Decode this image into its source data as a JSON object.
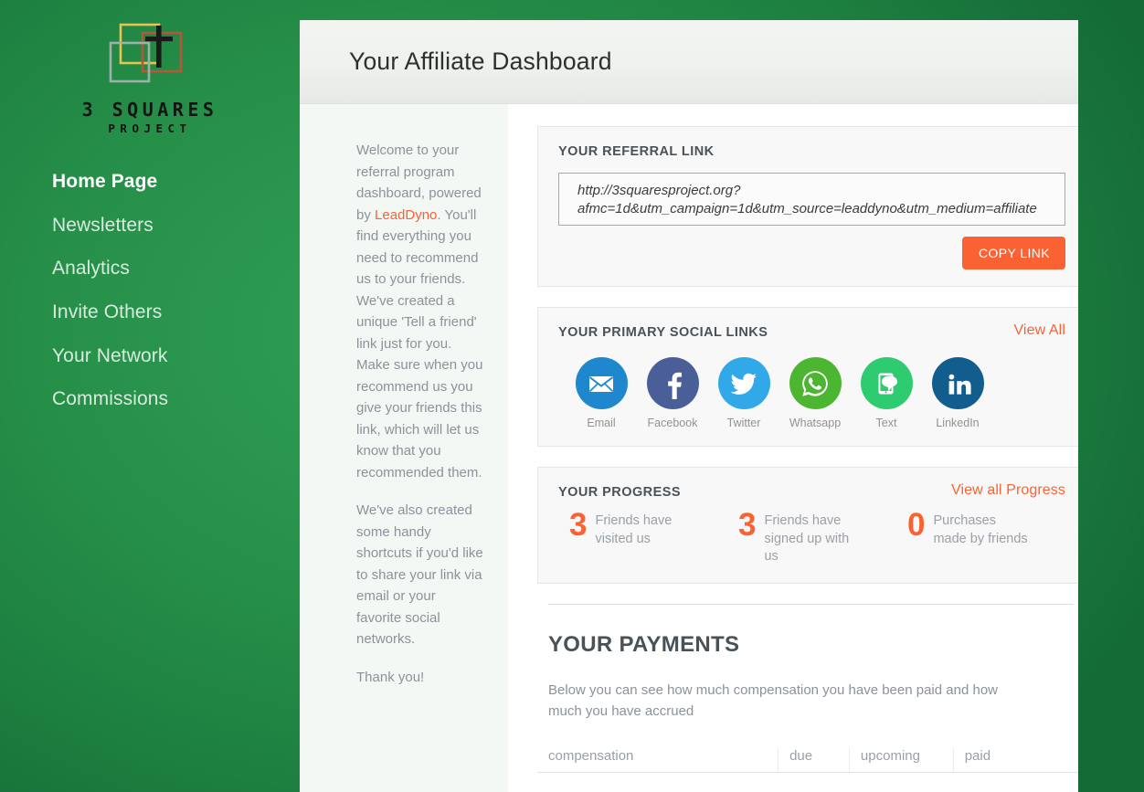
{
  "brand": {
    "logo_line1": "3 SQUARES",
    "logo_line2": "PROJECT",
    "colors": {
      "square_yellow": "#e8c44e",
      "square_red": "#b4583c",
      "square_gray": "#9fb0a6",
      "cross": "#1a1a1a",
      "sidebar_green": "#269049",
      "accent_orange": "#fa6234"
    }
  },
  "sidebar": {
    "items": [
      {
        "label": "Home Page",
        "active": true
      },
      {
        "label": "Newsletters",
        "active": false
      },
      {
        "label": "Analytics",
        "active": false
      },
      {
        "label": "Invite Others",
        "active": false
      },
      {
        "label": "Your Network",
        "active": false
      },
      {
        "label": "Commissions",
        "active": false
      }
    ]
  },
  "header": {
    "title": "Your Affiliate Dashboard"
  },
  "intro": {
    "paragraph1_before_link": "Welcome to your referral program dashboard, powered by ",
    "link_label": "LeadDyno",
    "paragraph1_after_link": ". You'll find everything you need to recommend us to your friends. We've created a unique 'Tell a friend' link just for you. Make sure when you recommend us you give your friends this link, which will let us know that you recommended them.",
    "paragraph2": "We've also created some handy shortcuts if you'd like to share your link via email or your favorite social networks.",
    "paragraph3": "Thank you!"
  },
  "referral": {
    "title": "YOUR REFERRAL LINK",
    "link_value": "http://3squaresproject.org?\nafmc=1d&utm_campaign=1d&utm_source=leaddyno&utm_medium=affiliate",
    "copy_button": "COPY LINK"
  },
  "social": {
    "title": "YOUR PRIMARY SOCIAL LINKS",
    "view_all": "View All",
    "items": [
      {
        "label": "Email",
        "icon": "email-envelope-icon",
        "color": "#1f87cd"
      },
      {
        "label": "Facebook",
        "icon": "facebook-icon",
        "color": "#4a5f97"
      },
      {
        "label": "Twitter",
        "icon": "twitter-bird-icon",
        "color": "#31a8e8"
      },
      {
        "label": "Whatsapp",
        "icon": "whatsapp-icon",
        "color": "#4cb531"
      },
      {
        "label": "Text",
        "icon": "text-message-icon",
        "color": "#2ecb70"
      },
      {
        "label": "LinkedIn",
        "icon": "linkedin-icon",
        "color": "#115e8e"
      }
    ]
  },
  "progress": {
    "title": "YOUR PROGRESS",
    "view_all": "View all Progress",
    "stats": [
      {
        "value": "3",
        "label": "Friends have visited us"
      },
      {
        "value": "3",
        "label": "Friends have signed up with us"
      },
      {
        "value": "0",
        "label": "Purchases made by friends"
      }
    ]
  },
  "payments": {
    "title": "YOUR PAYMENTS",
    "description": "Below you can see how much compensation you have been paid and how much you have accrued",
    "columns": [
      "compensation",
      "due",
      "upcoming",
      "paid"
    ],
    "rows": []
  }
}
